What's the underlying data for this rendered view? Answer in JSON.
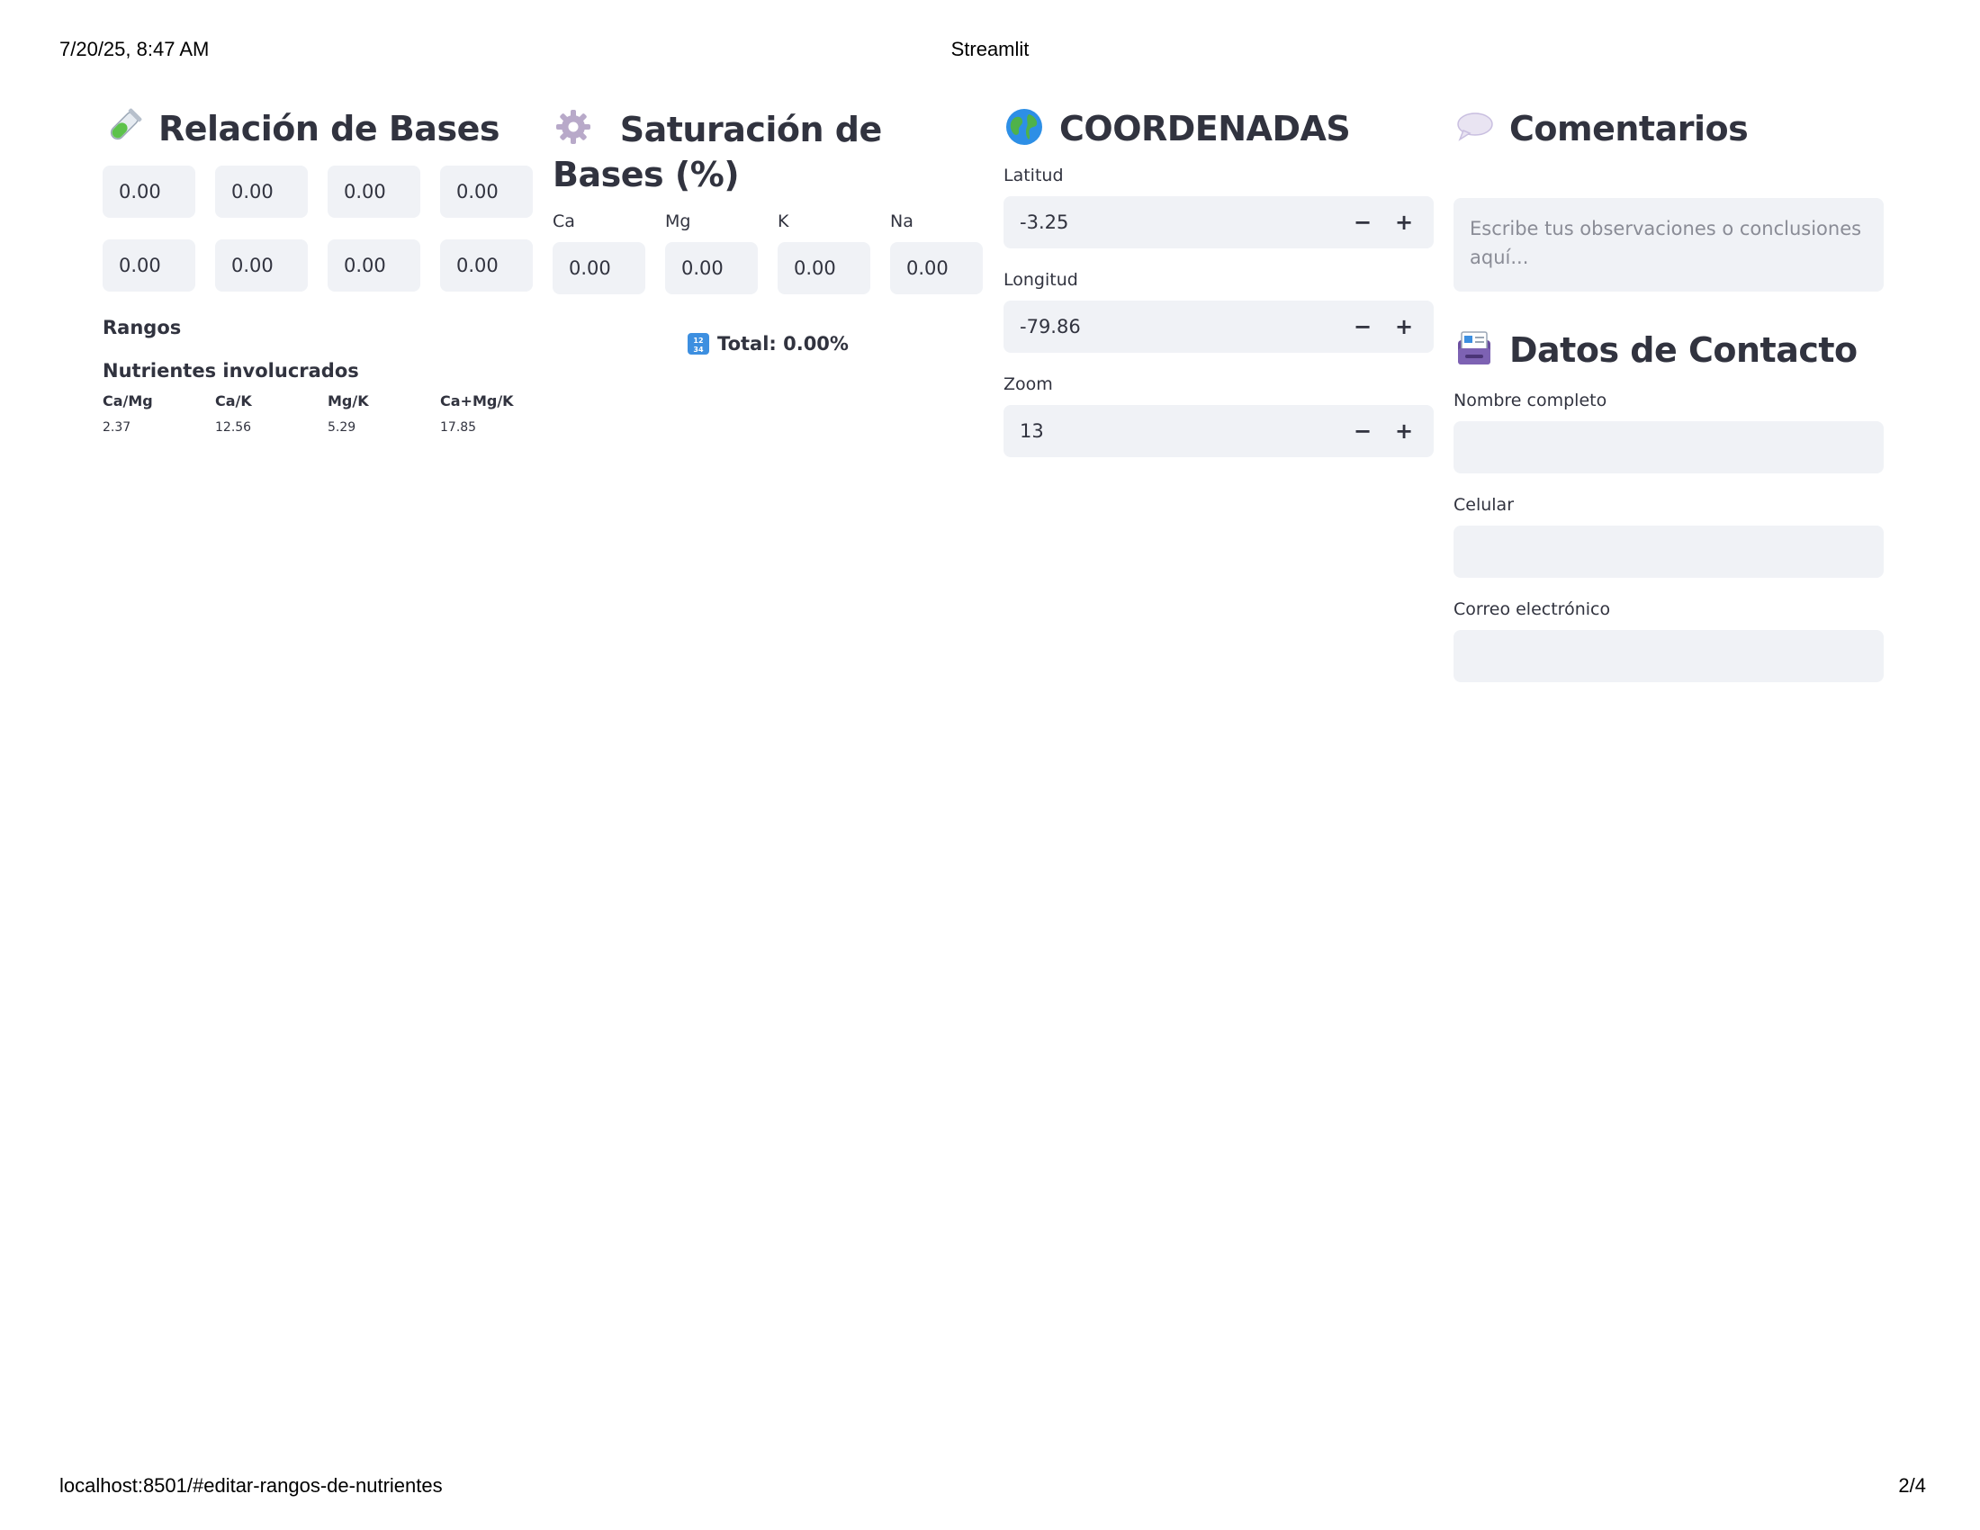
{
  "print_header": {
    "datetime": "7/20/25, 8:47 AM",
    "title": "Streamlit"
  },
  "print_footer": {
    "url": "localhost:8501/#editar-rangos-de-nutrientes",
    "page": "2/4"
  },
  "relacion": {
    "title": "Relación de Bases",
    "icon": "test-tube-icon",
    "row1": [
      "0.00",
      "0.00",
      "0.00",
      "0.00"
    ],
    "row2": [
      "0.00",
      "0.00",
      "0.00",
      "0.00"
    ],
    "rangos_label": "Rangos",
    "nutrientes_label": "Nutrientes involucrados",
    "ratios": [
      {
        "name": "Ca/Mg",
        "value": "2.37"
      },
      {
        "name": "Ca/K",
        "value": "12.56"
      },
      {
        "name": "Mg/K",
        "value": "5.29"
      },
      {
        "name": "Ca+Mg/K",
        "value": "17.85"
      }
    ]
  },
  "saturacion": {
    "title": "Saturación de Bases (%)",
    "icon": "gear-icon",
    "fields": [
      {
        "label": "Ca",
        "value": "0.00"
      },
      {
        "label": "Mg",
        "value": "0.00"
      },
      {
        "label": "K",
        "value": "0.00"
      },
      {
        "label": "Na",
        "value": "0.00"
      }
    ],
    "total_icon": "numbers-icon",
    "total": "Total: 0.00%"
  },
  "coordenadas": {
    "title": "COORDENADAS",
    "icon": "globe-icon",
    "latitud": {
      "label": "Latitud",
      "value": "-3.25"
    },
    "longitud": {
      "label": "Longitud",
      "value": "-79.86"
    },
    "zoom": {
      "label": "Zoom",
      "value": "13"
    },
    "minus": "−",
    "plus": "+"
  },
  "comentarios": {
    "title": "Comentarios",
    "icon": "speech-bubble-icon",
    "placeholder": "Escribe tus observaciones o conclusiones aquí..."
  },
  "contacto": {
    "title": "Datos de Contacto",
    "icon": "id-card-icon",
    "nombre_label": "Nombre completo",
    "celular_label": "Celular",
    "correo_label": "Correo electrónico"
  }
}
